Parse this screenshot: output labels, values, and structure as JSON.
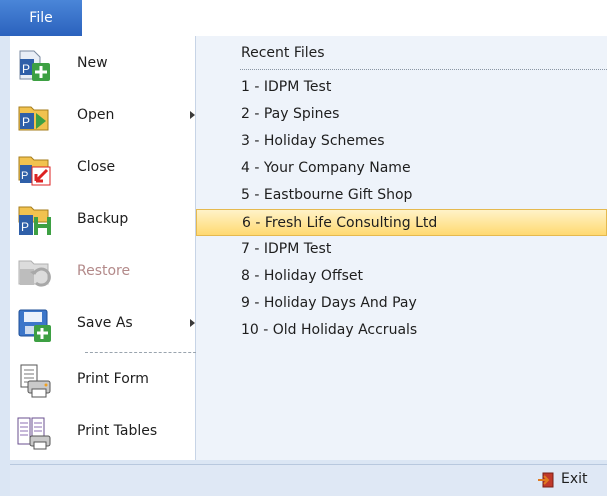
{
  "file_tab": {
    "label": "File"
  },
  "menu": {
    "items": [
      {
        "label": "New",
        "icon": "new-file-icon",
        "enabled": true,
        "submenu": false
      },
      {
        "label": "Open",
        "icon": "open-file-icon",
        "enabled": true,
        "submenu": true
      },
      {
        "label": "Close",
        "icon": "close-file-icon",
        "enabled": true,
        "submenu": false
      },
      {
        "label": "Backup",
        "icon": "backup-icon",
        "enabled": true,
        "submenu": false
      },
      {
        "label": "Restore",
        "icon": "restore-icon",
        "enabled": false,
        "submenu": false
      },
      {
        "label": "Save As",
        "icon": "save-as-icon",
        "enabled": true,
        "submenu": true
      },
      {
        "label": "Print Form",
        "icon": "print-form-icon",
        "enabled": true,
        "submenu": false
      },
      {
        "label": "Print Tables",
        "icon": "print-tables-icon",
        "enabled": true,
        "submenu": false
      }
    ]
  },
  "recent": {
    "header": "Recent Files",
    "items": [
      "1 - IDPM Test",
      "2 - Pay Spines",
      "3 - Holiday Schemes",
      "4 - Your Company Name",
      "5 - Eastbourne Gift Shop",
      "6 - Fresh Life Consulting Ltd",
      "7 - IDPM Test",
      "8 - Holiday Offset",
      "9 - Holiday Days And Pay",
      "10 - Old Holiday Accruals"
    ],
    "selected_index": 5
  },
  "footer": {
    "exit_label": "Exit",
    "exit_icon": "exit-icon"
  },
  "colors": {
    "accent": "#2b62bd",
    "highlight": "#ffd971",
    "pane_bg": "#dbe6f4"
  }
}
